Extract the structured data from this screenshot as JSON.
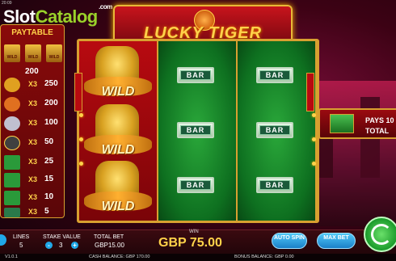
{
  "top_bar": {
    "clock": "20:09"
  },
  "watermark": {
    "slot": "Slot",
    "catalog": "Catalog",
    "com": ".com"
  },
  "logo": {
    "title": "LUCKY TIGER"
  },
  "paytable": {
    "title": "PAYTABLE",
    "wild_top_value": "200",
    "rows": [
      {
        "icon": "monk-icon",
        "x": "X3",
        "value": "250",
        "color": "#e0a020"
      },
      {
        "icon": "tiger-icon",
        "x": "X3",
        "value": "200",
        "color": "#e07020"
      },
      {
        "icon": "white-tiger-icon",
        "x": "X3",
        "value": "100",
        "color": "#c0c0d0"
      },
      {
        "icon": "coin-icon",
        "x": "X3",
        "value": "50",
        "color": "#404040"
      },
      {
        "icon": "cash-icon",
        "x": "X3",
        "value": "25",
        "color": "#2a9a3a"
      },
      {
        "icon": "cash-icon",
        "x": "X3",
        "value": "15",
        "color": "#2a9a3a"
      },
      {
        "icon": "cash-icon",
        "x": "X3",
        "value": "10",
        "color": "#2a9a3a"
      },
      {
        "icon": "bar-icon",
        "x": "X3",
        "value": "5",
        "color": "#2a7a4a"
      }
    ],
    "wild_mini_label": "WILD"
  },
  "reels": {
    "wild_label": "WILD",
    "bar_label": "BAR"
  },
  "pays_panel": {
    "line1": "PAYS 10",
    "line2": "TOTAL"
  },
  "bottom": {
    "lines_label": "LINES",
    "lines_value": "5",
    "stake_label": "STAKE VALUE",
    "stake_value": "3",
    "minus": "-",
    "plus": "+",
    "total_bet_label": "TOTAL BET",
    "total_bet_value": "GBP15.00",
    "win_label": "WIN",
    "win_value": "GBP 75.00",
    "auto_spin": "AUTO SPIN",
    "max_bet": "MAX BET"
  },
  "footer": {
    "version": "V1.0.1",
    "cash_balance": "CASH BALANCE: GBP 170.00",
    "bonus_balance": "BONUS BALANCE: GBP 0.00"
  }
}
